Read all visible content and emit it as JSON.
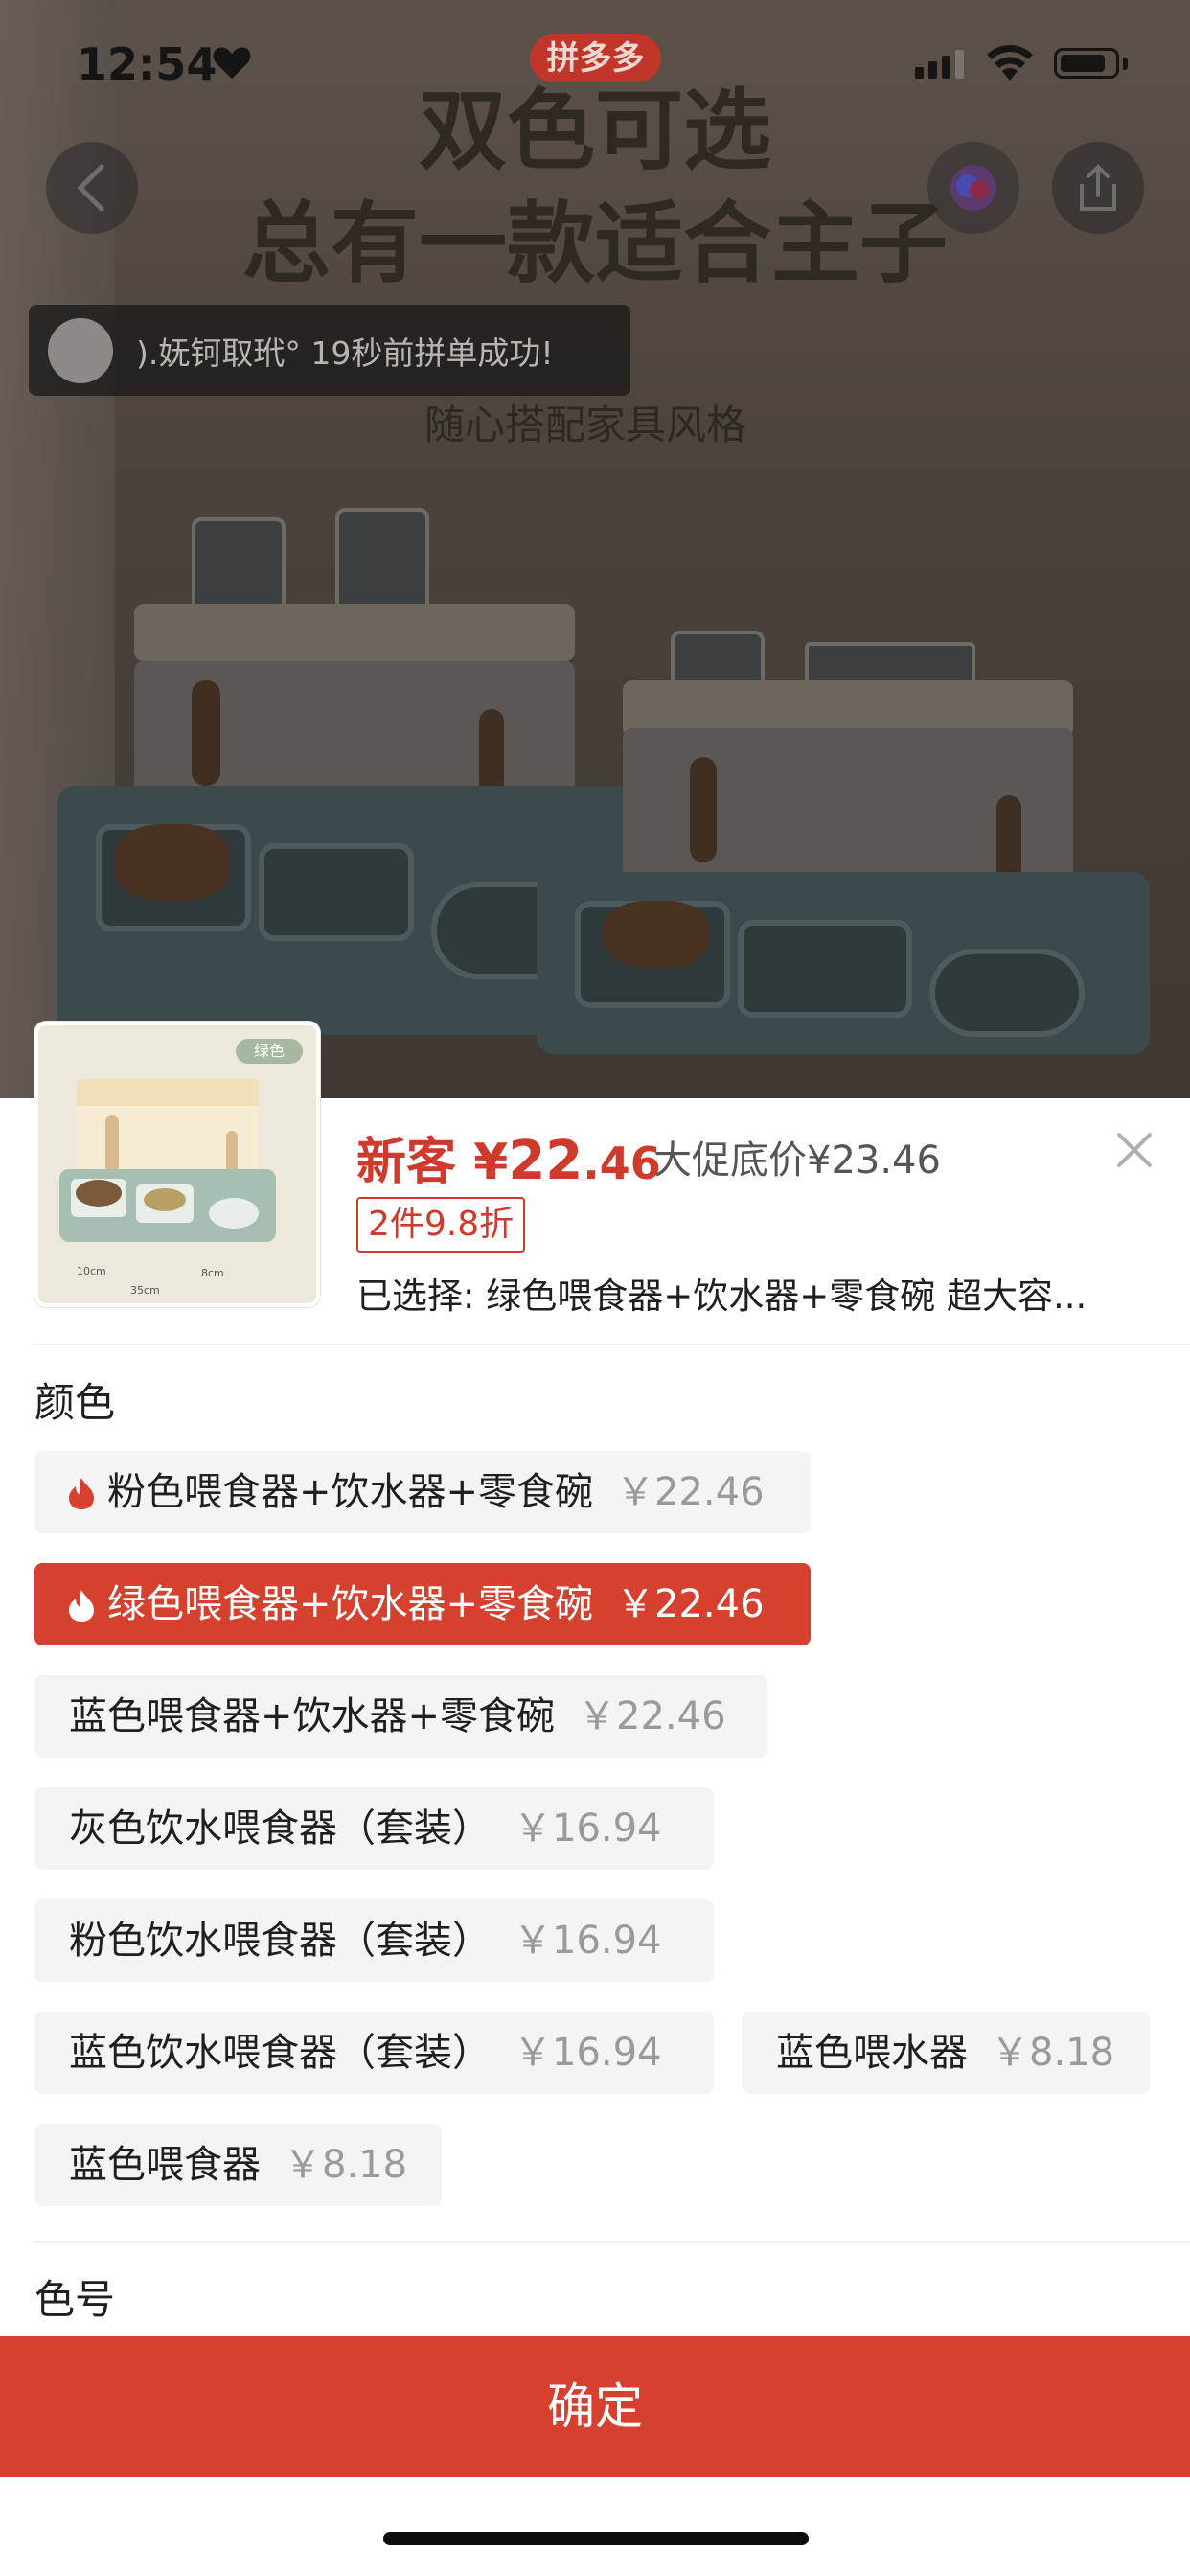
{
  "status_bar": {
    "time": "12:54",
    "battery_level": 0.85
  },
  "app": {
    "logo_text": "拼多多"
  },
  "banner": {
    "title_line1": "双色可选",
    "title_line2": "总有一款适合主子",
    "subtitle": "随心搭配家具风格",
    "toast": ").妩钶取玳° 19秒前拼单成功!"
  },
  "product": {
    "thumb_tag": "绿色",
    "price_prefix": "新客",
    "price_currency": "¥",
    "price_int": "22",
    "price_dec": ".46",
    "promo_price": "大促底价¥23.46",
    "discount": "2件9.8折",
    "selected": "已选择: 绿色喂食器+饮水器+零食碗 超大容..."
  },
  "color_section": {
    "label": "颜色",
    "options": [
      {
        "name": "粉色喂食器+饮水器+零食碗",
        "price": "￥22.46",
        "hot": true,
        "selected": false
      },
      {
        "name": "绿色喂食器+饮水器+零食碗",
        "price": "￥22.46",
        "hot": true,
        "selected": true
      },
      {
        "name": "蓝色喂食器+饮水器+零食碗",
        "price": "￥22.46",
        "hot": false,
        "selected": false
      },
      {
        "name": "灰色饮水喂食器（套装）",
        "price": "￥16.94",
        "hot": false,
        "selected": false
      },
      {
        "name": "粉色饮水喂食器（套装）",
        "price": "￥16.94",
        "hot": false,
        "selected": false
      },
      {
        "name": "蓝色饮水喂食器（套装）",
        "price": "￥16.94",
        "hot": false,
        "selected": false
      },
      {
        "name": "蓝色喂水器",
        "price": "￥8.18",
        "hot": false,
        "selected": false
      },
      {
        "name": "蓝色喂食器",
        "price": "￥8.18",
        "hot": false,
        "selected": false
      }
    ]
  },
  "shade_section": {
    "label": "色号"
  },
  "confirm_label": "确定",
  "colors": {
    "accent": "#d6412f",
    "price": "#d03a2c",
    "chip_bg": "#f4f4f4"
  }
}
